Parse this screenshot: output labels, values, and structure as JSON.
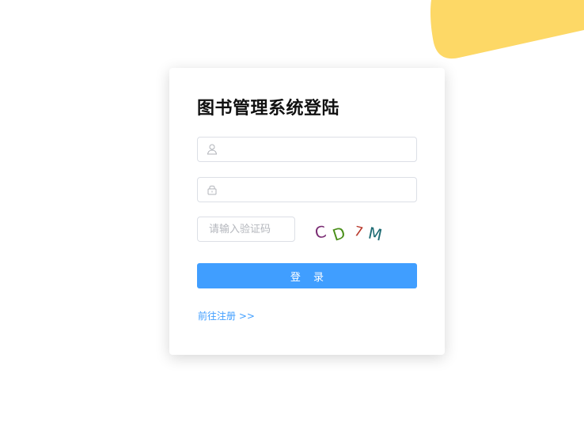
{
  "colors": {
    "accent": "#409eff",
    "decor_blob": "#fdd866",
    "input_border": "#dcdfe6",
    "title": "#111111"
  },
  "login": {
    "title": "图书管理系统登陆",
    "username": {
      "icon": "user-icon",
      "value": "",
      "placeholder": ""
    },
    "password": {
      "icon": "lock-icon",
      "value": "",
      "placeholder": ""
    },
    "captcha": {
      "placeholder": "请输入验证码",
      "value": "",
      "image_text": [
        "C",
        "D",
        "7",
        "M"
      ]
    },
    "submit_label": "登 录",
    "register_link": "前往注册 >>"
  }
}
